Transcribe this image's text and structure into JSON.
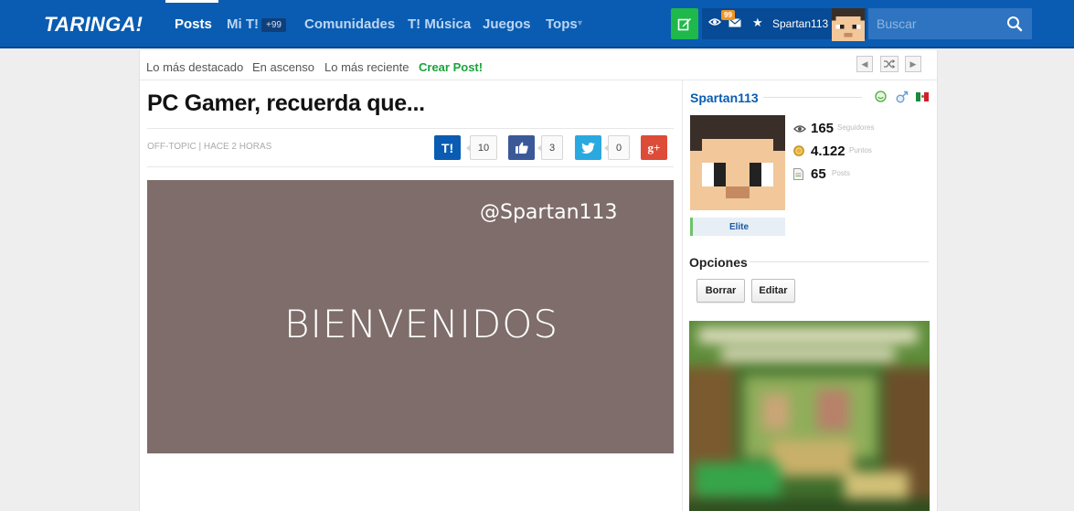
{
  "header": {
    "logo": "TARINGA!",
    "nav": [
      {
        "label": "Posts",
        "active": true
      },
      {
        "label": "Mi T!",
        "active": false
      },
      {
        "label": "Comunidades",
        "active": false
      },
      {
        "label": "T! Música",
        "active": false
      },
      {
        "label": "Juegos",
        "active": false
      },
      {
        "label": "Tops",
        "active": false
      }
    ],
    "mit_badge": "+99",
    "mail_badge": "99",
    "username": "Spartan113",
    "search_placeholder": "Buscar",
    "colors": {
      "bar": "#0a5cb2",
      "new_post": "#1fb84a"
    },
    "icons": [
      "new-post-icon",
      "eye-icon",
      "mail-icon",
      "star-icon",
      "search-icon"
    ]
  },
  "subnav": {
    "items": [
      "Lo más destacado",
      "En ascenso",
      "Lo más reciente",
      "Crear Post!"
    ],
    "pager": [
      "prev-icon",
      "shuffle-icon",
      "next-icon"
    ]
  },
  "post": {
    "title": "PC Gamer, recuerda que...",
    "meta": "OFF-TOPIC | HACE 2 HORAS",
    "shares": [
      {
        "network": "taringa",
        "glyph": "T!",
        "count": "10",
        "color": "#0a5cb2"
      },
      {
        "network": "facebook",
        "glyph": "like-icon",
        "count": "3",
        "color": "#3b5998"
      },
      {
        "network": "twitter",
        "glyph": "bird-icon",
        "count": "0",
        "color": "#2aa9e0"
      },
      {
        "network": "google-plus",
        "glyph": "g+",
        "count": "",
        "color": "#dd4b39"
      }
    ],
    "image": {
      "handle": "@Spartan113",
      "text": "BIENVENIDOS",
      "background": "#7e6d6a"
    }
  },
  "sidebar": {
    "username": "Spartan113",
    "rank": "Elite",
    "stats": [
      {
        "icon": "eye-icon",
        "value": "165",
        "label": "Seguidores"
      },
      {
        "icon": "coin-icon",
        "value": "4.122",
        "label": "Puntos"
      },
      {
        "icon": "document-icon",
        "value": "65",
        "label": "Posts"
      }
    ],
    "options_title": "Opciones",
    "buttons": [
      "Borrar",
      "Editar"
    ]
  }
}
